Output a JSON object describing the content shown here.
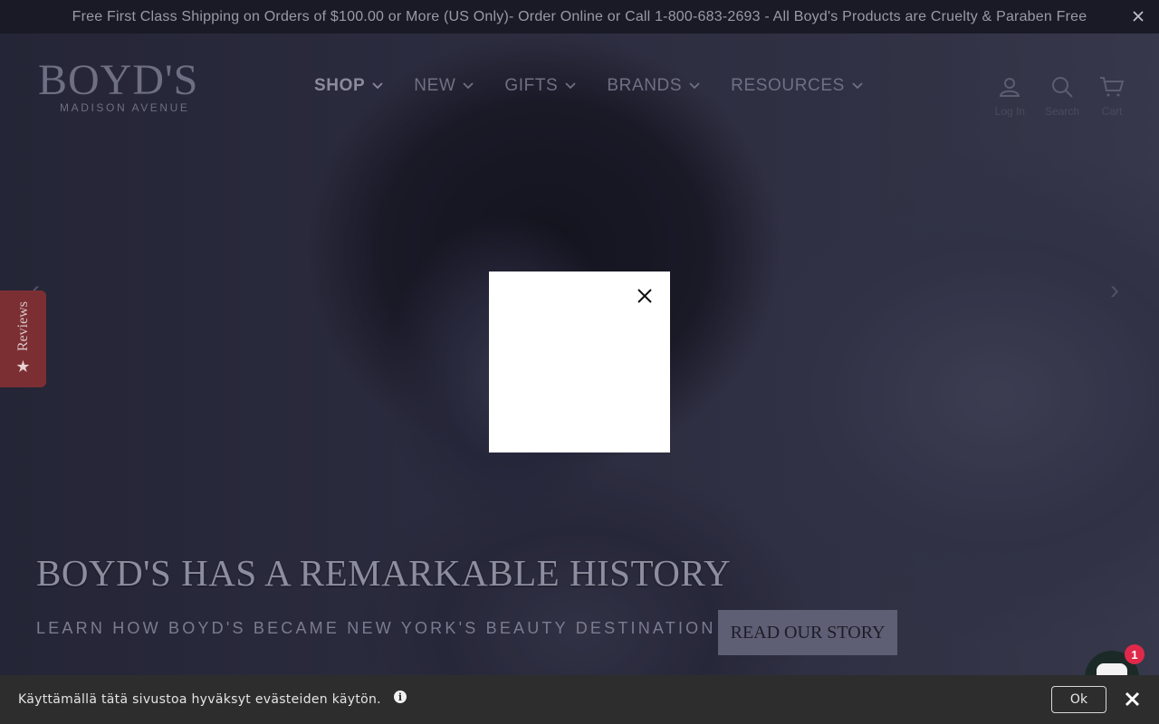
{
  "announcement": {
    "text": "Free First Class Shipping on Orders of $100.00 or More (US Only)- Order Online or Call 1-800-683-2693 - All Boyd's Products are Cruelty & Paraben Free"
  },
  "logo": {
    "main": "BOYD'S",
    "sub": "MADISON AVENUE"
  },
  "nav": {
    "items": [
      {
        "label": "SHOP"
      },
      {
        "label": "NEW"
      },
      {
        "label": "GIFTS"
      },
      {
        "label": "BRANDS"
      },
      {
        "label": "RESOURCES"
      }
    ]
  },
  "header_icons": {
    "login": "Log In",
    "search": "Search",
    "cart": "Cart"
  },
  "hero": {
    "title": "BOYD'S HAS A REMARKABLE HISTORY",
    "subtitle": "LEARN HOW BOYD'S BECAME NEW YORK'S BEAUTY DESTINATION",
    "button": "READ OUR STORY"
  },
  "reviews_tab": {
    "label": "Reviews"
  },
  "cookie": {
    "text": "Käyttämällä tätä sivustoa hyväksyt evästeiden käytön.",
    "ok": "Ok"
  },
  "chat": {
    "badge": "1"
  },
  "colors": {
    "announcement_bg": "#1a1a26",
    "reviews_tab": "#7c2f33",
    "cookie_bg": "#2d2d2d",
    "chat_badge": "#e0294a"
  }
}
